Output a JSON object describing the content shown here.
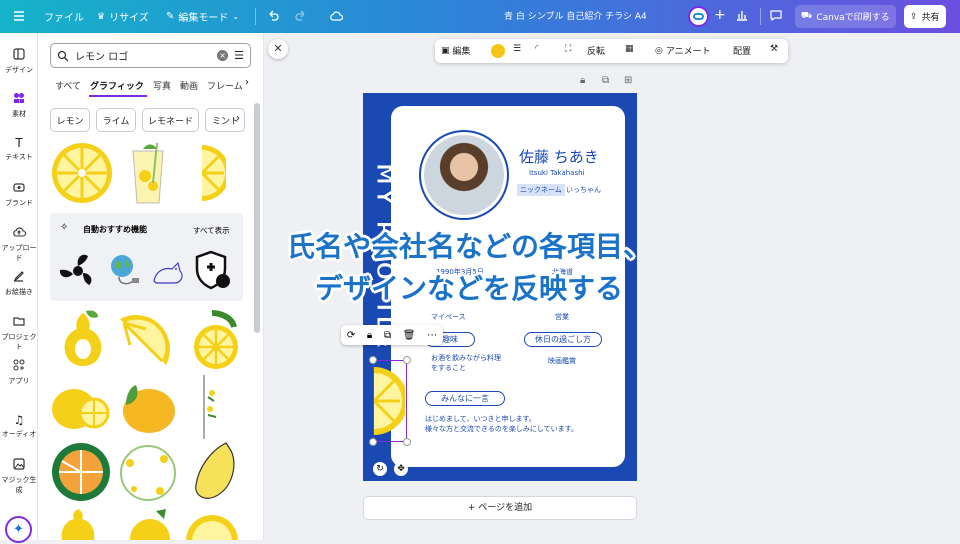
{
  "topbar": {
    "file": "ファイル",
    "resize": "リサイズ",
    "edit_mode": "編集モード",
    "title": "青 白 シンプル 自己紹介 チラシ A4",
    "print": "Canvaで印刷する",
    "share": "共有"
  },
  "rail": [
    "デザイン",
    "素材",
    "テキスト",
    "ブランド",
    "アップロード",
    "お絵描き",
    "プロジェクト",
    "アプリ",
    "オーディオ",
    "マジック生成"
  ],
  "panel": {
    "search_value": "レモン ロゴ",
    "tabs": [
      "すべて",
      "グラフィック",
      "写真",
      "動画",
      "フレーム"
    ],
    "chips": [
      "レモン",
      "ライム",
      "レモネード",
      "ミント"
    ],
    "rec_title": "自動おすすめ機能",
    "rec_all": "すべて表示"
  },
  "toolbar": {
    "edit": "編集",
    "flip": "反転",
    "animate": "アニメート",
    "arrange": "配置",
    "fill_color": "#f5c518"
  },
  "card": {
    "vertical": "MY PROFILE",
    "name": "佐藤 ちあき",
    "romaji": "Itsuki Takahashi",
    "nickname_label": "ニックネーム",
    "nickname": "いっちゃん",
    "birthday": "1990年3月5日",
    "hometown": "北海道",
    "personality": "マイペース",
    "job": "営業",
    "hobby_label": "趣味",
    "hobby": "お酒を飲みながら料理をすること",
    "holiday_label": "休日の過ごし方",
    "holiday": "映画鑑賞",
    "message_label": "みんなに一言",
    "message1": "はじめまして、いつきと申します。",
    "message2": "様々な方と交流できるのを楽しみにしています。"
  },
  "add_page": "+ ページを追加",
  "overlay": {
    "line1": "氏名や会社名などの各項目、",
    "line2": "デザインなどを反映する"
  },
  "colors": {
    "brand_blue": "#1b49b3",
    "accent_purple": "#7d2ae8",
    "lemon": "#f5d018"
  }
}
